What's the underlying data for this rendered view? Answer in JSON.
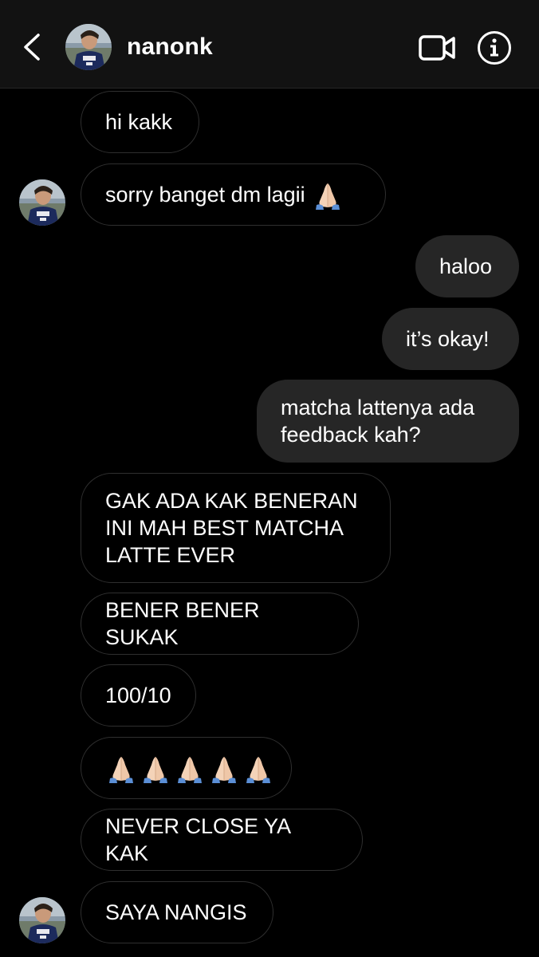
{
  "header": {
    "username": "nanonk"
  },
  "messages": [
    {
      "id": "m1",
      "text": "hi kakk"
    },
    {
      "id": "m2",
      "text": "sorry banget dm lagii"
    },
    {
      "id": "m3",
      "text": "haloo"
    },
    {
      "id": "m4",
      "text": "it’s okay!"
    },
    {
      "id": "m5",
      "text": "matcha lattenya ada\nfeedback kah?"
    },
    {
      "id": "m6",
      "text": "GAK ADA KAK BENERAN\nINI MAH BEST MATCHA\nLATTE EVER"
    },
    {
      "id": "m7",
      "text": "BENER BENER SUKAK"
    },
    {
      "id": "m8",
      "text": "100/10"
    },
    {
      "id": "m9",
      "emoji_count": 5,
      "emoji": "folded-hands-icon"
    },
    {
      "id": "m10",
      "text": "NEVER CLOSE YA KAK"
    },
    {
      "id": "m11",
      "text": "SAYA NANGIS"
    }
  ],
  "colors": {
    "background": "#000000",
    "header": "#121212",
    "sent_bubble": "#262626",
    "received_border": "#2f2f2f",
    "text": "#ffffff"
  }
}
